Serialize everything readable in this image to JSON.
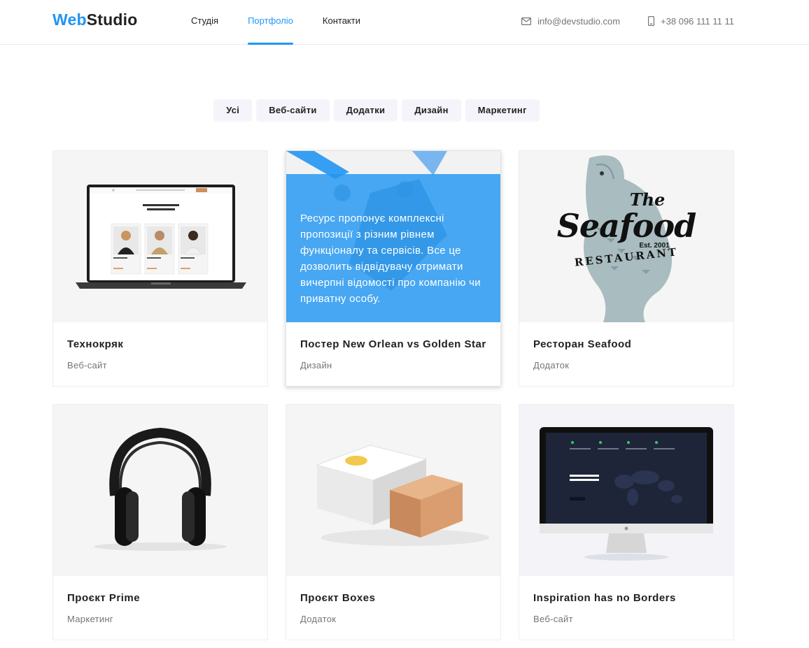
{
  "header": {
    "logo_part1": "Web",
    "logo_part2": "Studio",
    "nav": [
      {
        "label": "Студія"
      },
      {
        "label": "Портфоліо"
      },
      {
        "label": "Контакти"
      }
    ],
    "email": "info@devstudio.com",
    "phone": "+38 096 111 11 11",
    "accent_color": "#2196f3"
  },
  "filters": [
    {
      "label": "Усі"
    },
    {
      "label": "Веб-сайти"
    },
    {
      "label": "Додатки"
    },
    {
      "label": "Дизайн"
    },
    {
      "label": "Маркетинг"
    }
  ],
  "portfolio": [
    {
      "title": "Технокряк",
      "category": "Веб-сайт",
      "image": "laptop-mockup"
    },
    {
      "title": "Постер New Orlean vs Golden Star",
      "category": "Дизайн",
      "image": "basketball-poster",
      "overlay_text": "Ресурс пропонує комплексні пропозиції з різним рівнем функціоналу та сервісів. Все це дозволить відвідувачу отримати вичерпні відомості про компанію чи приватну особу."
    },
    {
      "title": "Ресторан Seafood",
      "category": "Додаток",
      "image": "seafood-logo",
      "logo_line1": "The",
      "logo_line2": "Seafood",
      "logo_line3": "Est. 2001",
      "logo_line4": "RESTAURANT"
    },
    {
      "title": "Проєкт Prime",
      "category": "Маркетинг",
      "image": "headphones"
    },
    {
      "title": "Проєкт Boxes",
      "category": "Додаток",
      "image": "boxes"
    },
    {
      "title": "Inspiration has no Borders",
      "category": "Веб-сайт",
      "image": "monitor-mockup"
    }
  ]
}
